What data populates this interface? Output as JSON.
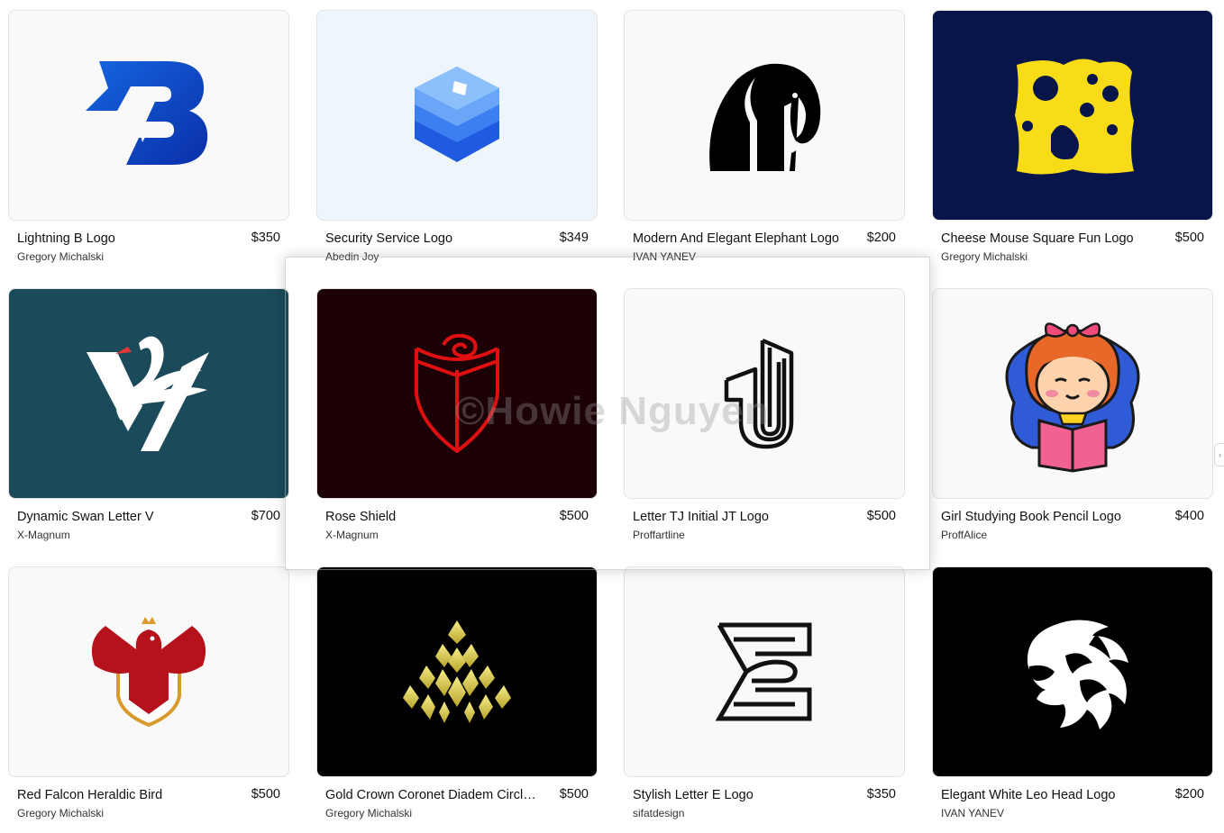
{
  "watermark": "©Howie Nguyen",
  "scroll_handle": "›",
  "cards": [
    {
      "title": "Lightning B Logo",
      "price": "$350",
      "author": "Gregory Michalski",
      "bg": "#f9f9f9",
      "icon": "lightning-b-logo-icon"
    },
    {
      "title": "Security Service Logo",
      "price": "$349",
      "author": "Abedin Joy",
      "bg": "#eef6fc",
      "icon": "blue-hexagon-cube-logo-icon"
    },
    {
      "title": "Modern And Elegant Elephant Logo",
      "price": "$200",
      "author": "IVAN YANEV",
      "bg": "#f9f9f9",
      "icon": "elephant-logo-icon"
    },
    {
      "title": "Cheese Mouse Square Fun Logo",
      "price": "$500",
      "author": "Gregory Michalski",
      "bg": "#07154a",
      "icon": "cheese-mouse-logo-icon"
    },
    {
      "title": "Dynamic Swan Letter V",
      "price": "$700",
      "author": "X-Magnum",
      "bg": "#1b4a5a",
      "icon": "swan-letter-v-logo-icon"
    },
    {
      "title": "Rose Shield",
      "price": "$500",
      "author": "X-Magnum",
      "bg": "#1c0107",
      "icon": "rose-shield-logo-icon"
    },
    {
      "title": "Letter TJ Initial JT Logo",
      "price": "$500",
      "author": "Proffartline",
      "bg": "#f9f9f9",
      "icon": "letter-tj-logo-icon"
    },
    {
      "title": "Girl Studying Book Pencil Logo",
      "price": "$400",
      "author": "ProffAlice",
      "bg": "#f9f9f9",
      "icon": "girl-reading-book-logo-icon"
    },
    {
      "title": "Red Falcon Heraldic Bird",
      "price": "$500",
      "author": "Gregory Michalski",
      "bg": "#f9f9f9",
      "icon": "red-falcon-logo-icon"
    },
    {
      "title": "Gold Crown Coronet Diadem Circlet ...",
      "price": "$500",
      "author": "Gregory Michalski",
      "bg": "#000000",
      "icon": "gold-crown-logo-icon"
    },
    {
      "title": "Stylish Letter E Logo",
      "price": "$350",
      "author": "sifatdesign",
      "bg": "#f9f9f9",
      "icon": "letter-e-logo-icon"
    },
    {
      "title": "Elegant White Leo Head Logo",
      "price": "$200",
      "author": "IVAN YANEV",
      "bg": "#000000",
      "icon": "lion-head-logo-icon"
    }
  ]
}
